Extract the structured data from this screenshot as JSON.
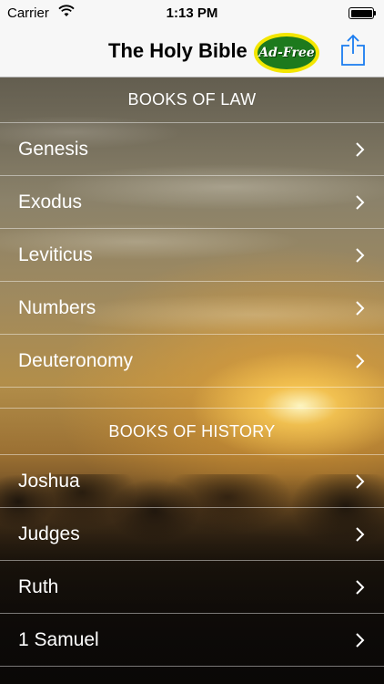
{
  "status_bar": {
    "carrier": "Carrier",
    "time": "1:13 PM"
  },
  "nav_bar": {
    "title": "The Holy Bible",
    "ad_badge": "Ad-Free",
    "share_icon": "share-icon"
  },
  "sections": [
    {
      "header": "BOOKS OF LAW",
      "rows": [
        "Genesis",
        "Exodus",
        "Leviticus",
        "Numbers",
        "Deuteronomy"
      ]
    },
    {
      "header": "BOOKS OF HISTORY",
      "rows": [
        "Joshua",
        "Judges",
        "Ruth",
        "1 Samuel"
      ]
    }
  ],
  "colors": {
    "bar_background": "#f7f7f7",
    "accent": "#1a7cf0",
    "badge_green": "#1d7a1d",
    "badge_ring": "#f3e600",
    "row_text": "#ffffff"
  }
}
